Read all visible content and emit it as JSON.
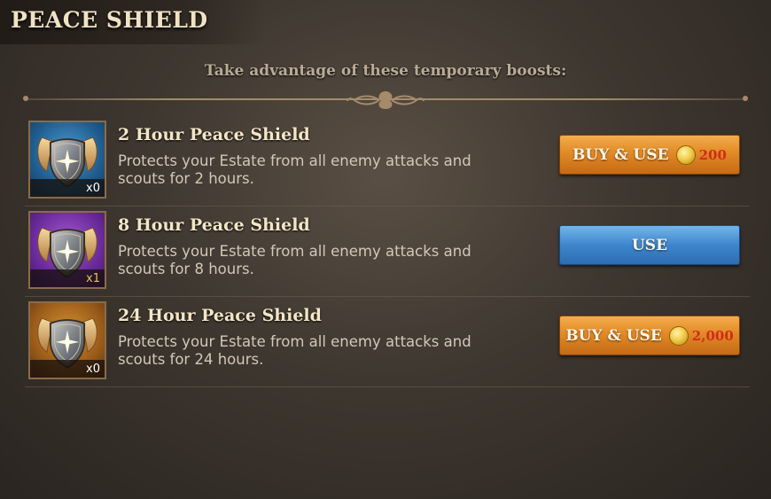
{
  "header": {
    "title": "PEACE SHIELD"
  },
  "subtitle": "Take advantage of these temporary boosts:",
  "items": [
    {
      "name": "2 Hour Peace Shield",
      "description": "Protects your Estate from all enemy attacks and scouts for 2 hours.",
      "count": "x0",
      "icon": "shield-icon",
      "frame_color": "#1f5d8f",
      "button_label": "BUY & USE",
      "price": "200",
      "price_icon": "gold-coin-icon"
    },
    {
      "name": "8 Hour Peace Shield",
      "description": "Protects your Estate from all enemy attacks and scouts for 8 hours.",
      "count": "x1",
      "icon": "shield-icon",
      "frame_color": "#6a2a9a",
      "button_label": "USE"
    },
    {
      "name": "24 Hour Peace Shield",
      "description": "Protects your Estate from all enemy attacks and scouts for 24 hours.",
      "count": "x0",
      "icon": "shield-icon",
      "frame_color": "#9a5b1a",
      "button_label": "BUY & USE",
      "price": "2,000",
      "price_icon": "gold-coin-icon"
    }
  ],
  "colors": {
    "buy_button": "#e18a26",
    "use_button": "#3e86cc",
    "price_text": "#d22b1a",
    "title_text": "#f0e2c4"
  }
}
